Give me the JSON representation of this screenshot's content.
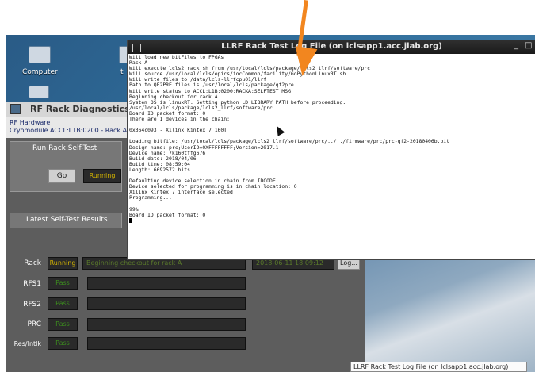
{
  "desktop": {
    "icons": [
      {
        "label": "Computer",
        "icon": "computer-icon"
      },
      {
        "label": "t",
        "icon": "folder-icon"
      }
    ]
  },
  "annotation": {
    "color": "#f2861f"
  },
  "rf_window": {
    "title": "RF Rack Diagnostics - A",
    "info_line1": "RF Hardware",
    "info_line2": "Cryomodule ACCL:L1B:0200 - Rack A",
    "self_test_panel": {
      "heading": "Run Rack Self-Test",
      "go_label": "Go",
      "running_label": "Running"
    },
    "results_panel": {
      "heading": "Latest Self-Test Results"
    },
    "rows": [
      {
        "label": "Rack",
        "status": "Running",
        "message": "Beginning checkout for rack A",
        "timestamp": "2018-06-11 18:09:12",
        "log_label": "Log..."
      },
      {
        "label": "RFS1",
        "status": "Pass"
      },
      {
        "label": "RFS2",
        "status": "Pass"
      },
      {
        "label": "PRC",
        "status": "Pass"
      },
      {
        "label": "Res/Intlk",
        "status": "Pass"
      }
    ],
    "colors": {
      "running": "#d4b400",
      "pass": "#3c8c1e"
    }
  },
  "terminal": {
    "title": "LLRF Rack Test Log File (on lclsapp1.acc.jlab.org)",
    "lines": [
      "Will load new bitFiles to FPGAs",
      "Rack A",
      "Will execute lcls2_rack.sh from /usr/local/lcls/package/lcls2_llrf/software/prc",
      "Will source /usr/local/lcls/epics/iocCommon/facility/GoPythonLinuxRT.sh",
      "Will write files to /data/lcls-llrfcpu01/llrf",
      "Path to QF2PRE files is /usr/local/lcls/package/qf2pre",
      "Will write status to ACCL:L1B:0200:RACKA:SELFTEST_MSG",
      "Beginning checkout for rack A",
      "System OS is linuxRT. Setting python LD_LIBRARY_PATH before proceeding.",
      "/usr/local/lcls/package/lcls2_llrf/software/prc",
      "Board ID packet format: 0",
      "There are 1 devices in the chain:",
      "",
      "0x364c093 - Xilinx Kintex 7 160T",
      "",
      "Loading bitfile: /usr/local/lcls/package/lcls2_llrf/software/prc/../../firmware/prc/prc-qf2-20180406b.bit",
      "Design name: prc;UserID=0XFFFFFFFF;Version=2017.1",
      "Device name: 7k160tffg676",
      "Build date: 2018/04/06",
      "Build time: 08:59:04",
      "Length: 6692572 bits",
      "",
      "Defaulting device selection in chain from IDCODE",
      "Device selected for programming is in chain location: 0",
      "Xilinx Kintex 7 interface selected",
      "Programming...",
      "",
      "99%",
      "Board ID packet format: 0"
    ]
  },
  "taskbar": {
    "tooltip": "LLRF Rack Test Log File (on lclsapp1.acc.jlab.org)"
  }
}
